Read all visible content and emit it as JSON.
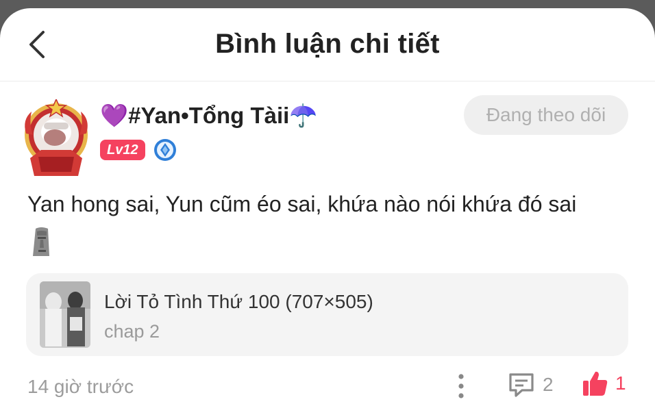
{
  "header": {
    "title": "Bình luận chi tiết",
    "back_icon": "chevron-left-icon"
  },
  "user": {
    "name": "💜#Yan•Tổng Tàii☂️",
    "level": "Lv12",
    "avatar_number": "76",
    "follow_label": "Đang theo dõi"
  },
  "comment": {
    "text": "Yan hong sai, Yun cũm éo sai, khứa nào nói khứa đó sai",
    "emoji": "moai-emoji"
  },
  "manga": {
    "title": "Lời Tỏ Tình Thứ 100 (707×505)",
    "chapter": "chap 2"
  },
  "footer": {
    "time": "14 giờ trước",
    "reply_count": "2",
    "like_count": "1"
  },
  "colors": {
    "accent": "#f5425f",
    "muted": "#9c9c9c"
  }
}
